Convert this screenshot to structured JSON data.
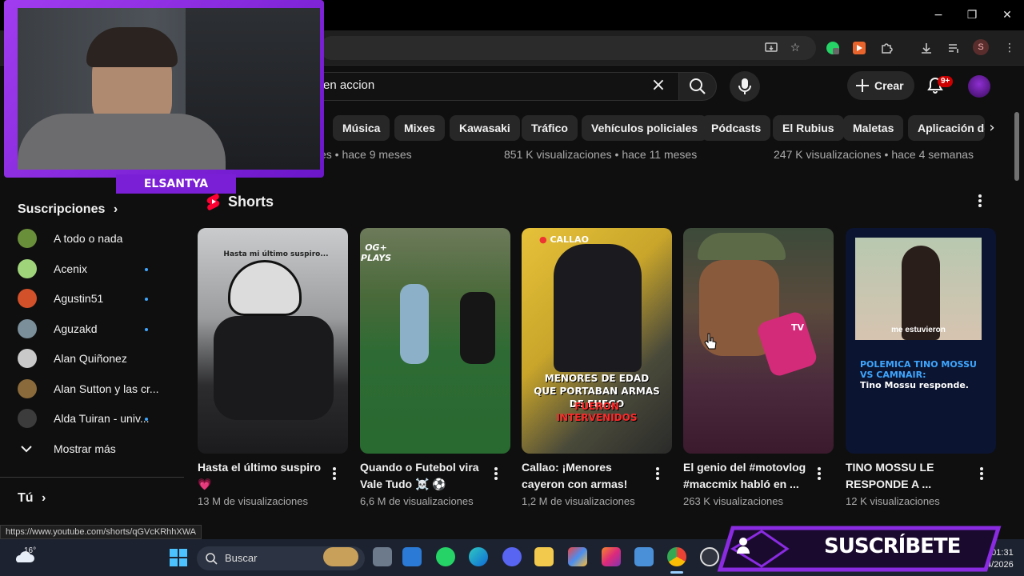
{
  "browser": {
    "controls": {
      "minimize": "−",
      "restore": "❐",
      "close": "✕"
    },
    "profile_initial": "S"
  },
  "youtube": {
    "search": {
      "value": "en accion",
      "clear_icon": "close-icon",
      "button_icon": "search-icon"
    },
    "create_label": "Crear",
    "notifications_badge": "9+",
    "chips": [
      "Música",
      "Mixes",
      "Kawasaki",
      "Tráfico",
      "Vehículos policiales",
      "Pódcasts",
      "El Rubius",
      "Maletas",
      "Aplicación de"
    ],
    "top_meta": [
      "es • hace 9 meses",
      "851 K visualizaciones • hace 11 meses",
      "247 K visualizaciones • hace 4 semanas"
    ]
  },
  "sidebar": {
    "subscriptions_heading": "Suscripciones",
    "channels": [
      {
        "name": "A todo o nada",
        "new": false,
        "color": "#6a8f3a"
      },
      {
        "name": "Acenix",
        "new": true,
        "color": "#9fd47b"
      },
      {
        "name": "Agustin51",
        "new": true,
        "color": "#d2502a"
      },
      {
        "name": "Aguzakd",
        "new": true,
        "color": "#7a8f9a"
      },
      {
        "name": "Alan Quiñonez",
        "new": false,
        "color": "#c9c9c9"
      },
      {
        "name": "Alan Sutton y las cr...",
        "new": false,
        "color": "#8a6a3a"
      },
      {
        "name": "Alda Tuiran - univ...",
        "new": true,
        "color": "#3c3c3c"
      }
    ],
    "show_more": "Mostrar más",
    "you_heading": "Tú"
  },
  "shorts": {
    "heading": "Shorts",
    "items": [
      {
        "title": "Hasta el último suspiro💗",
        "views": "13 M de visualizaciones",
        "overlay": "Hasta mi último suspiro..."
      },
      {
        "title": "Quando o Futebol vira Vale Tudo ☠️ ⚽",
        "views": "6,6 M de visualizaciones",
        "overlay": "OG+ PLAYS"
      },
      {
        "title": "Callao: ¡Menores cayeron con armas!",
        "views": "1,2 M de visualizaciones",
        "overlay_tag": "CALLAO",
        "overlay_line1": "MENORES DE EDAD QUE PORTABAN ARMAS DE FUEGO",
        "overlay_line2": "FUERON INTERVENIDOS"
      },
      {
        "title": "El genio del #motovlog #maccmix habló en ...",
        "views": "263 K visualizaciones",
        "overlay": "TV"
      },
      {
        "title": "TINO MOSSU LE RESPONDE A ...",
        "views": "12 K visualizaciones",
        "overlay_caption": "me estuvieron",
        "overlay_head": "POLEMICA TINO MOSSU VS CAMNAIR:",
        "overlay_sub": "Tino Mossu responde."
      }
    ]
  },
  "status_url": "https://www.youtube.com/shorts/qGVcKRhhXWA",
  "taskbar": {
    "temperature": "16°",
    "search_label": "Buscar",
    "time": "01:31",
    "date": "/4/2026"
  },
  "overlay": {
    "streamer_name": "ELSANTYA",
    "subscribe_label": "SUSCRÍBETE"
  },
  "colors": {
    "accent_purple": "#8a2be2",
    "badge_red": "#cc0000",
    "link_blue": "#3ea6ff"
  }
}
